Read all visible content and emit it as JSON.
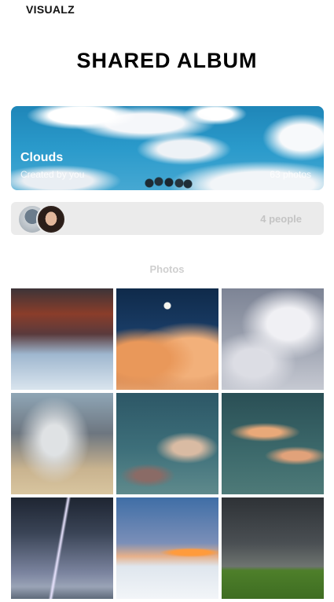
{
  "header": {
    "brand": "VISUALZ",
    "title": "SHARED ALBUM"
  },
  "album": {
    "name": "Clouds",
    "creator": "Created by you",
    "photo_count": "63 photos"
  },
  "members": {
    "count_label": "4 people",
    "avatars": [
      "avatar",
      "avatar"
    ]
  },
  "photos_section": {
    "label": "Photos",
    "items": [
      "photo-1",
      "photo-2",
      "photo-3",
      "photo-4",
      "photo-5",
      "photo-6",
      "photo-7",
      "photo-8",
      "photo-9"
    ]
  },
  "colors": {
    "background": "#ffffff",
    "members_bar": "#ebebeb",
    "muted_text": "#c4c4c4"
  }
}
